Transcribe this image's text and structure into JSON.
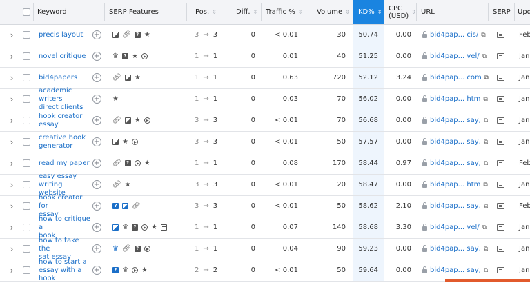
{
  "header": {
    "keyword": "Keyword",
    "serp_features": "SERP Features",
    "pos": "Pos.",
    "diff": "Diff.",
    "traffic": "Traffic %",
    "volume": "Volume",
    "kd": "KD%",
    "cpc_line1": "CPC",
    "cpc_line2": "(USD)",
    "url": "URL",
    "serp": "SERP",
    "updated": "Upd"
  },
  "rows": [
    {
      "keyword": [
        "precis layout"
      ],
      "features": [
        "image",
        "link",
        "faq",
        "star"
      ],
      "pos_prev": "3",
      "pos": "3",
      "diff": "0",
      "traffic": "< 0.01",
      "volume": "30",
      "kd": "50.74",
      "cpc": "0.00",
      "url": "bid4pap... cis/",
      "updated": "Feb"
    },
    {
      "keyword": [
        "novel critique"
      ],
      "features": [
        "crown",
        "faq",
        "star",
        "video"
      ],
      "pos_prev": "1",
      "pos": "1",
      "diff": "0",
      "traffic": "0.01",
      "volume": "40",
      "kd": "51.25",
      "cpc": "0.00",
      "url": "bid4pap... vel/",
      "updated": "Jan"
    },
    {
      "keyword": [
        "bid4papers"
      ],
      "features": [
        "link",
        "image",
        "star"
      ],
      "pos_prev": "1",
      "pos": "1",
      "diff": "0",
      "traffic": "0.63",
      "volume": "720",
      "kd": "52.12",
      "cpc": "3.24",
      "url": "bid4pap... com",
      "updated": "Jan"
    },
    {
      "keyword": [
        "academic writers",
        "direct clients"
      ],
      "features": [
        "star"
      ],
      "pos_prev": "1",
      "pos": "1",
      "diff": "0",
      "traffic": "0.03",
      "volume": "70",
      "kd": "56.02",
      "cpc": "0.00",
      "url": "bid4pap... htm",
      "updated": "Jan"
    },
    {
      "keyword": [
        "hook creator",
        "essay"
      ],
      "features": [
        "link",
        "image",
        "star",
        "video"
      ],
      "pos_prev": "3",
      "pos": "3",
      "diff": "0",
      "traffic": "< 0.01",
      "volume": "70",
      "kd": "56.68",
      "cpc": "0.00",
      "url": "bid4pap... say,",
      "updated": "Jan"
    },
    {
      "keyword": [
        "creative hook",
        "generator"
      ],
      "features": [
        "image",
        "star",
        "video"
      ],
      "pos_prev": "3",
      "pos": "3",
      "diff": "0",
      "traffic": "< 0.01",
      "volume": "50",
      "kd": "57.57",
      "cpc": "0.00",
      "url": "bid4pap... say,",
      "updated": "Jan"
    },
    {
      "keyword": [
        "read my paper"
      ],
      "features": [
        "link",
        "faq",
        "video",
        "star"
      ],
      "pos_prev": "1",
      "pos": "1",
      "diff": "0",
      "traffic": "0.08",
      "volume": "170",
      "kd": "58.44",
      "cpc": "0.97",
      "url": "bid4pap... say,",
      "updated": "Feb"
    },
    {
      "keyword": [
        "easy essay writing",
        "website"
      ],
      "features": [
        "link",
        "star"
      ],
      "pos_prev": "3",
      "pos": "3",
      "diff": "0",
      "traffic": "< 0.01",
      "volume": "20",
      "kd": "58.47",
      "cpc": "0.00",
      "url": "bid4pap... htm",
      "updated": "Jan"
    },
    {
      "keyword": [
        "hook creator for",
        "essay"
      ],
      "features": [
        "faq-blue",
        "image-blue",
        "link"
      ],
      "pos_prev": "3",
      "pos": "3",
      "diff": "0",
      "traffic": "< 0.01",
      "volume": "50",
      "kd": "58.62",
      "cpc": "2.10",
      "url": "bid4pap... say,",
      "updated": "Feb"
    },
    {
      "keyword": [
        "how to critique a",
        "book"
      ],
      "features": [
        "image-blue",
        "crown",
        "faq",
        "video",
        "star",
        "local"
      ],
      "pos_prev": "1",
      "pos": "1",
      "diff": "0",
      "traffic": "0.07",
      "volume": "140",
      "kd": "58.68",
      "cpc": "3.30",
      "url": "bid4pap... vel/",
      "updated": "Jan"
    },
    {
      "keyword": [
        "how to take the",
        "sat essay"
      ],
      "features": [
        "crown-blue",
        "link",
        "faq",
        "video"
      ],
      "pos_prev": "1",
      "pos": "1",
      "diff": "0",
      "traffic": "0.04",
      "volume": "90",
      "kd": "59.23",
      "cpc": "0.00",
      "url": "bid4pap... say,",
      "updated": "Jan"
    },
    {
      "keyword": [
        "how to start a",
        "essay with a hook"
      ],
      "features": [
        "faq-blue",
        "crown",
        "video",
        "star"
      ],
      "pos_prev": "2",
      "pos": "2",
      "diff": "0",
      "traffic": "< 0.01",
      "volume": "50",
      "kd": "59.64",
      "cpc": "0.00",
      "url": "bid4pap... say,",
      "updated": "Jan"
    }
  ]
}
